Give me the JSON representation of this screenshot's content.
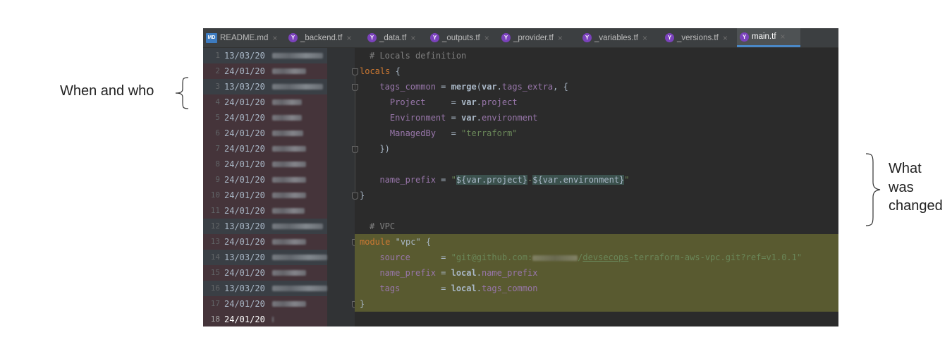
{
  "annotations": {
    "left": "When and who",
    "right": [
      "What",
      "was",
      "changed"
    ]
  },
  "tabs": [
    {
      "label": "README.md",
      "icon": "markdown-icon",
      "active": false
    },
    {
      "label": "_backend.tf",
      "icon": "terraform-icon",
      "active": false
    },
    {
      "label": "_data.tf",
      "icon": "terraform-icon",
      "active": false
    },
    {
      "label": "_outputs.tf",
      "icon": "terraform-icon",
      "active": false
    },
    {
      "label": "_provider.tf",
      "icon": "terraform-icon",
      "active": false
    },
    {
      "label": "_variables.tf",
      "icon": "terraform-icon",
      "active": false
    },
    {
      "label": "_versions.tf",
      "icon": "terraform-icon",
      "active": false
    },
    {
      "label": "main.tf",
      "icon": "terraform-icon",
      "active": true
    }
  ],
  "md_icon_text": "MD",
  "tf_icon_text": "Y",
  "close_glyph": "×",
  "annotate": [
    {
      "line": "1",
      "date": "13/03/20"
    },
    {
      "line": "2",
      "date": "24/01/20"
    },
    {
      "line": "3",
      "date": "13/03/20"
    },
    {
      "line": "4",
      "date": "24/01/20"
    },
    {
      "line": "5",
      "date": "24/01/20"
    },
    {
      "line": "6",
      "date": "24/01/20"
    },
    {
      "line": "7",
      "date": "24/01/20"
    },
    {
      "line": "8",
      "date": "24/01/20"
    },
    {
      "line": "9",
      "date": "24/01/20"
    },
    {
      "line": "10",
      "date": "24/01/20"
    },
    {
      "line": "11",
      "date": "24/01/20"
    },
    {
      "line": "12",
      "date": "13/03/20"
    },
    {
      "line": "13",
      "date": "24/01/20"
    },
    {
      "line": "14",
      "date": "13/03/20"
    },
    {
      "line": "15",
      "date": "24/01/20"
    },
    {
      "line": "16",
      "date": "13/03/20"
    },
    {
      "line": "17",
      "date": "24/01/20"
    },
    {
      "line": "18",
      "date": "24/01/20"
    }
  ],
  "code": [
    {
      "segs": [
        {
          "t": "# Locals definition",
          "c": "comment"
        }
      ]
    },
    {
      "segs": [
        {
          "t": "locals",
          "c": "kw"
        },
        {
          "t": " {",
          "c": "id"
        }
      ]
    },
    {
      "segs": [
        {
          "t": "  tags_common",
          "c": "attr"
        },
        {
          "t": " = ",
          "c": "id"
        },
        {
          "t": "merge",
          "c": "id"
        },
        {
          "t": "(",
          "c": "id"
        },
        {
          "t": "var",
          "c": "id"
        },
        {
          "t": ".",
          "c": "id"
        },
        {
          "t": "tags_extra",
          "c": "attr"
        },
        {
          "t": ", {",
          "c": "id"
        }
      ]
    },
    {
      "segs": [
        {
          "t": "    Project",
          "c": "attr"
        },
        {
          "t": "     = ",
          "c": "id"
        },
        {
          "t": "var",
          "c": "id"
        },
        {
          "t": ".",
          "c": "id"
        },
        {
          "t": "project",
          "c": "attr"
        }
      ]
    },
    {
      "segs": [
        {
          "t": "    Environment",
          "c": "attr"
        },
        {
          "t": " = ",
          "c": "id"
        },
        {
          "t": "var",
          "c": "id"
        },
        {
          "t": ".",
          "c": "id"
        },
        {
          "t": "environment",
          "c": "attr"
        }
      ]
    },
    {
      "segs": [
        {
          "t": "    ManagedBy",
          "c": "attr"
        },
        {
          "t": "   = ",
          "c": "id"
        },
        {
          "t": "\"terraform\"",
          "c": "str"
        }
      ]
    },
    {
      "segs": [
        {
          "t": "  })",
          "c": "id"
        }
      ]
    },
    {
      "segs": []
    },
    {
      "segs": [
        {
          "t": "  name_prefix",
          "c": "attr"
        },
        {
          "t": " = ",
          "c": "id"
        },
        {
          "t": "\"",
          "c": "str"
        },
        {
          "t": "${var.project}",
          "c": "interp"
        },
        {
          "t": "-",
          "c": "str"
        },
        {
          "t": "${var.environment}",
          "c": "interp"
        },
        {
          "t": "\"",
          "c": "str"
        }
      ]
    },
    {
      "segs": [
        {
          "t": "}",
          "c": "id"
        }
      ]
    },
    {
      "segs": []
    },
    {
      "segs": [
        {
          "t": "# VPC",
          "c": "comment"
        }
      ]
    },
    {
      "segs": [
        {
          "t": "module",
          "c": "kw"
        },
        {
          "t": " ",
          "c": "id"
        },
        {
          "t": "\"vpc\"",
          "c": "id"
        },
        {
          "t": " {",
          "c": "id"
        }
      ],
      "hl": true
    },
    {
      "segs": [
        {
          "t": "  source",
          "c": "attr"
        },
        {
          "t": "      = ",
          "c": "id"
        },
        {
          "t": "\"git@github.com:",
          "c": "str"
        },
        {
          "t": "",
          "c": "blur"
        },
        {
          "t": "/",
          "c": "str"
        },
        {
          "t": "devsecops",
          "c": "link"
        },
        {
          "t": "-terraform-aws-vpc.git?ref=v1.0.1\"",
          "c": "str"
        }
      ],
      "hl": true
    },
    {
      "segs": [
        {
          "t": "  name_prefix",
          "c": "attr"
        },
        {
          "t": " = ",
          "c": "id"
        },
        {
          "t": "local",
          "c": "id"
        },
        {
          "t": ".",
          "c": "id"
        },
        {
          "t": "name_prefix",
          "c": "attr"
        }
      ],
      "hl": true
    },
    {
      "segs": [
        {
          "t": "  tags",
          "c": "attr"
        },
        {
          "t": "        = ",
          "c": "id"
        },
        {
          "t": "local",
          "c": "id"
        },
        {
          "t": ".",
          "c": "id"
        },
        {
          "t": "tags_common",
          "c": "attr"
        }
      ],
      "hl": true
    },
    {
      "segs": [
        {
          "t": "}",
          "c": "id"
        }
      ],
      "hl": true
    },
    {
      "segs": []
    }
  ]
}
